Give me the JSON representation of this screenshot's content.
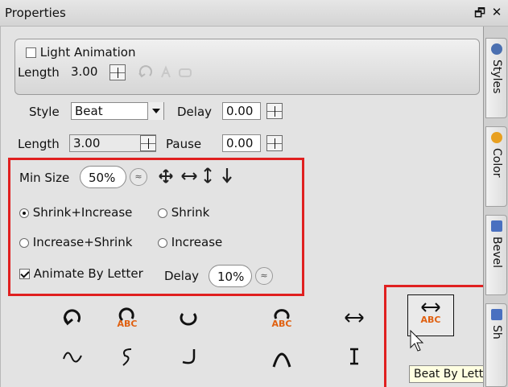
{
  "window": {
    "title": "Properties",
    "float_glyph": "🗗",
    "close_glyph": "✕"
  },
  "light_animation": {
    "label": "Light Animation",
    "checked": false,
    "length_label": "Length",
    "length_value": "3.00"
  },
  "style_row": {
    "style_label": "Style",
    "style_value": "Beat",
    "delay_label": "Delay",
    "delay_value": "0.00"
  },
  "length_row": {
    "length_label": "Length",
    "length_value": "3.00",
    "pause_label": "Pause",
    "pause_value": "0.00"
  },
  "size_group": {
    "min_size_label": "Min Size",
    "min_size_value": "50%",
    "shrink_increase": "Shrink+Increase",
    "shrink": "Shrink",
    "increase_shrink": "Increase+Shrink",
    "increase": "Increase",
    "selected_mode": "Shrink+Increase",
    "animate_by_letter": "Animate By Letter",
    "animate_checked": true,
    "delay_label": "Delay",
    "delay_value": "10%"
  },
  "effects": {
    "abc_text": "ABC"
  },
  "side_tabs": [
    "Styles",
    "Color",
    "Bevel",
    "Sh"
  ],
  "tooltip": {
    "text": "Beat By Lette"
  },
  "colors": {
    "highlight_box": "#e02020",
    "abc_accent": "#e06010"
  }
}
